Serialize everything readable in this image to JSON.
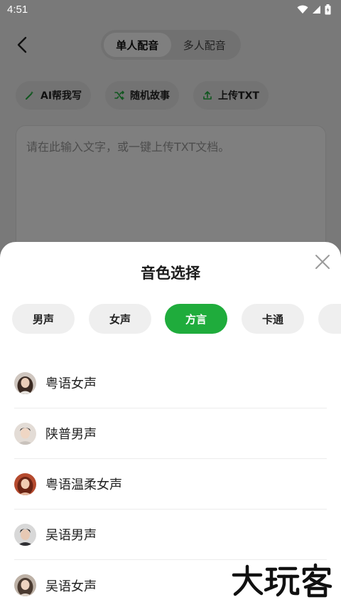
{
  "status_bar": {
    "time": "4:51"
  },
  "header": {
    "tabs": [
      {
        "label": "单人配音",
        "active": true
      },
      {
        "label": "多人配音",
        "active": false
      }
    ]
  },
  "toolbar": {
    "ai_write": "AI帮我写",
    "random_story": "随机故事",
    "upload_txt": "上传TXT"
  },
  "editor": {
    "placeholder": "请在此输入文字，或一键上传TXT文档。"
  },
  "sheet": {
    "title": "音色选择",
    "categories": [
      {
        "label": "男声",
        "active": false
      },
      {
        "label": "女声",
        "active": false
      },
      {
        "label": "方言",
        "active": true
      },
      {
        "label": "卡通",
        "active": false
      },
      {
        "label": "",
        "active": false
      }
    ],
    "voices": [
      {
        "name": "粤语女声",
        "avatar": "female-portrait-avatar"
      },
      {
        "name": "陕普男声",
        "avatar": "male-portrait-avatar"
      },
      {
        "name": "粤语温柔女声",
        "avatar": "female-portrait-avatar"
      },
      {
        "name": "吴语男声",
        "avatar": "male-portrait-avatar"
      },
      {
        "name": "吴语女声",
        "avatar": "female-portrait-avatar"
      }
    ]
  },
  "watermark": {
    "text": "大玩客"
  },
  "colors": {
    "accent": "#1fac3c",
    "chip_bg": "#efefef",
    "overlay": "rgba(0,0,0,0.5)"
  }
}
